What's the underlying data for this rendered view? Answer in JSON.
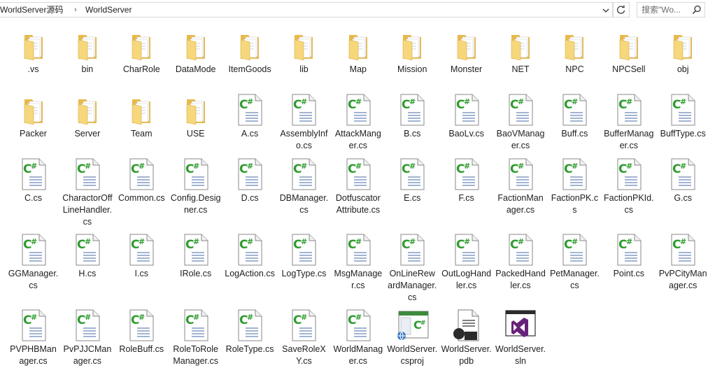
{
  "breadcrumb": {
    "parts": [
      "WorldServer源码",
      "WorldServer"
    ],
    "separator": "›"
  },
  "search": {
    "placeholder": "搜索\"Wo..."
  },
  "colors": {
    "folder": "#f2cd6a",
    "cs_green": "#2e9b2e",
    "border": "#d9d9d9",
    "vs_purple": "#68217a"
  },
  "files": [
    {
      "name": ".vs",
      "type": "folder",
      "icon": "folder-icon"
    },
    {
      "name": "bin",
      "type": "folder",
      "icon": "folder-icon"
    },
    {
      "name": "CharRole",
      "type": "folder",
      "icon": "folder-icon"
    },
    {
      "name": "DataMode",
      "type": "folder",
      "icon": "folder-icon"
    },
    {
      "name": "ItemGoods",
      "type": "folder",
      "icon": "folder-icon"
    },
    {
      "name": "lib",
      "type": "folder",
      "icon": "folder-icon"
    },
    {
      "name": "Map",
      "type": "folder",
      "icon": "folder-icon"
    },
    {
      "name": "Mission",
      "type": "folder",
      "icon": "folder-icon"
    },
    {
      "name": "Monster",
      "type": "folder",
      "icon": "folder-icon"
    },
    {
      "name": "NET",
      "type": "folder",
      "icon": "folder-icon"
    },
    {
      "name": "NPC",
      "type": "folder",
      "icon": "folder-icon"
    },
    {
      "name": "NPCSell",
      "type": "folder",
      "icon": "folder-icon"
    },
    {
      "name": "obj",
      "type": "folder",
      "icon": "folder-icon"
    },
    {
      "name": "Packer",
      "type": "folder",
      "icon": "folder-icon"
    },
    {
      "name": "Server",
      "type": "folder",
      "icon": "folder-icon"
    },
    {
      "name": "Team",
      "type": "folder",
      "icon": "folder-icon"
    },
    {
      "name": "USE",
      "type": "folder",
      "icon": "folder-icon"
    },
    {
      "name": "A.cs",
      "type": "cs",
      "icon": "csharp-file-icon"
    },
    {
      "name": "AssemblyInfo.cs",
      "type": "cs",
      "icon": "csharp-file-icon"
    },
    {
      "name": "AttackManger.cs",
      "type": "cs",
      "icon": "csharp-file-icon"
    },
    {
      "name": "B.cs",
      "type": "cs",
      "icon": "csharp-file-icon"
    },
    {
      "name": "BaoLv.cs",
      "type": "cs",
      "icon": "csharp-file-icon"
    },
    {
      "name": "BaoVManager.cs",
      "type": "cs",
      "icon": "csharp-file-icon"
    },
    {
      "name": "Buff.cs",
      "type": "cs",
      "icon": "csharp-file-icon"
    },
    {
      "name": "BufferManager.cs",
      "type": "cs",
      "icon": "csharp-file-icon"
    },
    {
      "name": "BuffType.cs",
      "type": "cs",
      "icon": "csharp-file-icon"
    },
    {
      "name": "C.cs",
      "type": "cs",
      "icon": "csharp-file-icon"
    },
    {
      "name": "CharactorOffLineHandler.cs",
      "type": "cs",
      "icon": "csharp-file-icon"
    },
    {
      "name": "Common.cs",
      "type": "cs",
      "icon": "csharp-file-icon"
    },
    {
      "name": "Config.Designer.cs",
      "type": "cs",
      "icon": "csharp-file-icon"
    },
    {
      "name": "D.cs",
      "type": "cs",
      "icon": "csharp-file-icon"
    },
    {
      "name": "DBManager.cs",
      "type": "cs",
      "icon": "csharp-file-icon"
    },
    {
      "name": "DotfuscatorAttribute.cs",
      "type": "cs",
      "icon": "csharp-file-icon"
    },
    {
      "name": "E.cs",
      "type": "cs",
      "icon": "csharp-file-icon"
    },
    {
      "name": "F.cs",
      "type": "cs",
      "icon": "csharp-file-icon"
    },
    {
      "name": "FactionManager.cs",
      "type": "cs",
      "icon": "csharp-file-icon"
    },
    {
      "name": "FactionPK.cs",
      "type": "cs",
      "icon": "csharp-file-icon"
    },
    {
      "name": "FactionPKId.cs",
      "type": "cs",
      "icon": "csharp-file-icon"
    },
    {
      "name": "G.cs",
      "type": "cs",
      "icon": "csharp-file-icon"
    },
    {
      "name": "GGManager.cs",
      "type": "cs",
      "icon": "csharp-file-icon"
    },
    {
      "name": "H.cs",
      "type": "cs",
      "icon": "csharp-file-icon"
    },
    {
      "name": "I.cs",
      "type": "cs",
      "icon": "csharp-file-icon"
    },
    {
      "name": "IRole.cs",
      "type": "cs",
      "icon": "csharp-file-icon"
    },
    {
      "name": "LogAction.cs",
      "type": "cs",
      "icon": "csharp-file-icon"
    },
    {
      "name": "LogType.cs",
      "type": "cs",
      "icon": "csharp-file-icon"
    },
    {
      "name": "MsgManager.cs",
      "type": "cs",
      "icon": "csharp-file-icon"
    },
    {
      "name": "OnLineRewardManager.cs",
      "type": "cs",
      "icon": "csharp-file-icon"
    },
    {
      "name": "OutLogHandler.cs",
      "type": "cs",
      "icon": "csharp-file-icon"
    },
    {
      "name": "PackedHandler.cs",
      "type": "cs",
      "icon": "csharp-file-icon"
    },
    {
      "name": "PetManager.cs",
      "type": "cs",
      "icon": "csharp-file-icon"
    },
    {
      "name": "Point.cs",
      "type": "cs",
      "icon": "csharp-file-icon"
    },
    {
      "name": "PvPCityManager.cs",
      "type": "cs",
      "icon": "csharp-file-icon"
    },
    {
      "name": "PVPHBManager.cs",
      "type": "cs",
      "icon": "csharp-file-icon"
    },
    {
      "name": "PvPJJCManager.cs",
      "type": "cs",
      "icon": "csharp-file-icon"
    },
    {
      "name": "RoleBuff.cs",
      "type": "cs",
      "icon": "csharp-file-icon"
    },
    {
      "name": "RoleToRoleManager.cs",
      "type": "cs",
      "icon": "csharp-file-icon"
    },
    {
      "name": "RoleType.cs",
      "type": "cs",
      "icon": "csharp-file-icon"
    },
    {
      "name": "SaveRoleXY.cs",
      "type": "cs",
      "icon": "csharp-file-icon"
    },
    {
      "name": "WorldManager.cs",
      "type": "cs",
      "icon": "csharp-file-icon"
    },
    {
      "name": "WorldServer.csproj",
      "type": "csproj",
      "icon": "csproj-file-icon"
    },
    {
      "name": "WorldServer.pdb",
      "type": "pdb",
      "icon": "pdb-file-icon"
    },
    {
      "name": "WorldServer.sln",
      "type": "sln",
      "icon": "sln-file-icon"
    }
  ]
}
